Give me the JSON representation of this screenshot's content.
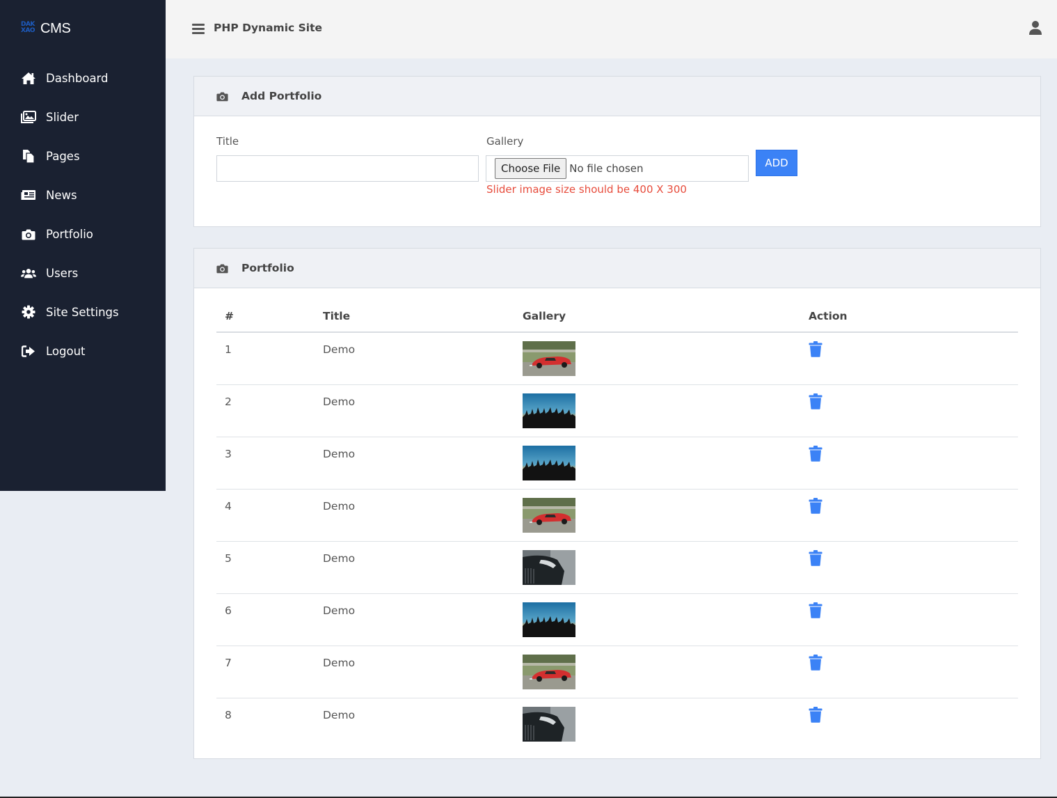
{
  "brand": {
    "mark_lines": [
      "DAK",
      "XAO"
    ],
    "name": "CMS"
  },
  "sidebar": {
    "items": [
      {
        "label": "Dashboard",
        "icon": "home-icon"
      },
      {
        "label": "Slider",
        "icon": "images-icon"
      },
      {
        "label": "Pages",
        "icon": "copy-icon"
      },
      {
        "label": "News",
        "icon": "newspaper-icon"
      },
      {
        "label": "Portfolio",
        "icon": "camera-icon"
      },
      {
        "label": "Users",
        "icon": "users-icon"
      },
      {
        "label": "Site Settings",
        "icon": "gear-icon"
      },
      {
        "label": "Logout",
        "icon": "sign-out-icon"
      }
    ]
  },
  "topbar": {
    "title": "PHP Dynamic Site",
    "menu_icon": "hamburger-icon",
    "user_icon": "user-icon"
  },
  "add_portfolio": {
    "header": "Add Portfolio",
    "title_label": "Title",
    "title_value": "",
    "gallery_label": "Gallery",
    "file_button": "Choose File",
    "file_status": "No file chosen",
    "hint": "Slider image size should be 400 X 300",
    "add_button": "ADD"
  },
  "portfolio": {
    "header": "Portfolio",
    "columns": [
      "#",
      "Title",
      "Gallery",
      "Action"
    ],
    "rows": [
      {
        "num": "1",
        "title": "Demo",
        "image": "red-race-car"
      },
      {
        "num": "2",
        "title": "Demo",
        "image": "sunset-crowd"
      },
      {
        "num": "3",
        "title": "Demo",
        "image": "sunset-crowd"
      },
      {
        "num": "4",
        "title": "Demo",
        "image": "red-race-car"
      },
      {
        "num": "5",
        "title": "Demo",
        "image": "dark-car-headlight"
      },
      {
        "num": "6",
        "title": "Demo",
        "image": "sunset-crowd"
      },
      {
        "num": "7",
        "title": "Demo",
        "image": "red-race-car"
      },
      {
        "num": "8",
        "title": "Demo",
        "image": "dark-car-headlight"
      }
    ]
  },
  "colors": {
    "sidebar_bg": "#1a2131",
    "accent": "#3b82f6",
    "hint": "#e74c3c",
    "page_bg": "#e9edf3"
  }
}
